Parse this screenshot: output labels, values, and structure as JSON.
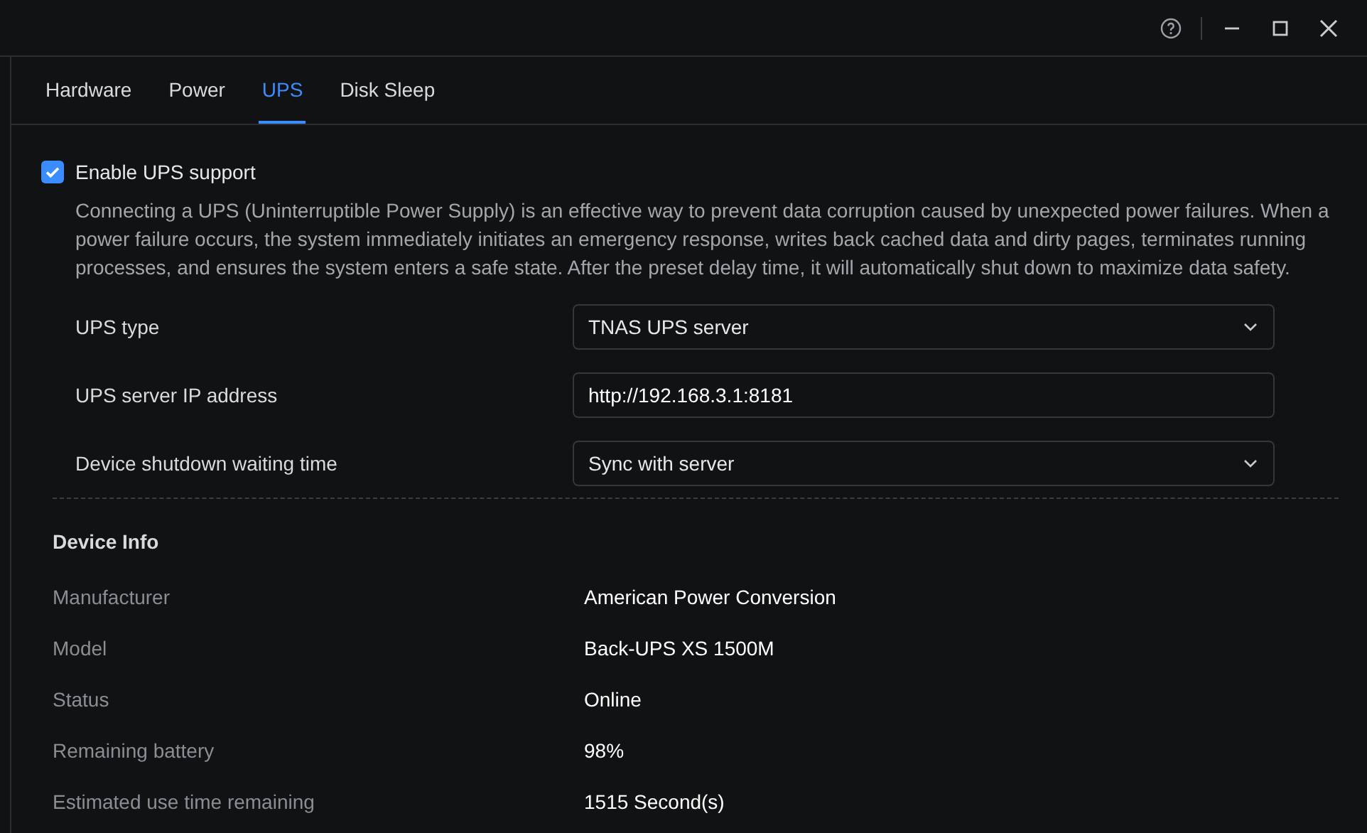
{
  "title_bar": {
    "buttons": [
      {
        "kind": "help"
      },
      {
        "kind": "minimize"
      },
      {
        "kind": "maximize"
      },
      {
        "kind": "close"
      }
    ]
  },
  "tabs": [
    {
      "label": "Hardware",
      "selected": false
    },
    {
      "label": "Power",
      "selected": false
    },
    {
      "label": "UPS",
      "selected": true
    },
    {
      "label": "Disk Sleep",
      "selected": false
    }
  ],
  "ups": {
    "enable": {
      "label": "Enable UPS support",
      "checked": true
    },
    "description": "Connecting a UPS (Uninterruptible Power Supply) is an effective way to prevent data corruption caused by unexpected power failures. When a power failure occurs, the system immediately initiates an emergency response, writes back cached data and dirty pages, terminates running processes, and ensures the system enters a safe state. After the preset delay time, it will automatically shut down to maximize data safety.",
    "fields": [
      {
        "kind": "select",
        "label": "UPS type",
        "value": "TNAS UPS server"
      },
      {
        "kind": "input",
        "label": "UPS server IP address",
        "value": "http://192.168.3.1:8181"
      },
      {
        "kind": "select",
        "label": "Device shutdown waiting time",
        "value": "Sync with server"
      }
    ]
  },
  "device_info": {
    "title": "Device Info",
    "rows": [
      {
        "label": "Manufacturer",
        "value": "American Power Conversion"
      },
      {
        "label": "Model",
        "value": "Back-UPS XS 1500M"
      },
      {
        "label": "Status",
        "value": "Online"
      },
      {
        "label": "Remaining battery",
        "value": "98%"
      },
      {
        "label": "Estimated use time remaining",
        "value": "1515 Second(s)"
      }
    ]
  }
}
